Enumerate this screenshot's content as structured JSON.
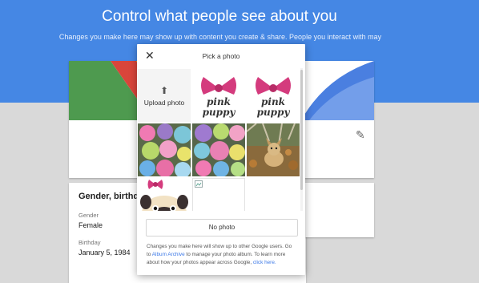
{
  "hero": {
    "title": "Control what people see about you",
    "subtitle": "Changes you make here may show up with content you create & share. People you interact with may"
  },
  "profile_section": {
    "title": "Gender, birthday",
    "gender_label": "Gender",
    "gender_value": "Female",
    "birthday_label": "Birthday",
    "birthday_value": "January 5, 1984",
    "edit_icon": "pencil-icon"
  },
  "dialog": {
    "title": "Pick a photo",
    "close_icon": "close-icon",
    "upload_label": "Upload photo",
    "upload_icon": "upload-icon",
    "logo_text_1": "pink",
    "logo_text_2": "puppy",
    "no_photo_label": "No photo",
    "info_text_1": "Changes you make here will show up to other Google users. Go to",
    "info_link_1": "Album Archive",
    "info_text_2": "to manage your photo album. To learn more about how your photos appear across Google,",
    "info_link_2": "click here."
  },
  "colors": {
    "hero_blue": "#4587e4",
    "page_grey": "#d9d9d9",
    "link_blue": "#3b78e7",
    "bow_pink": "#d43b7d"
  }
}
